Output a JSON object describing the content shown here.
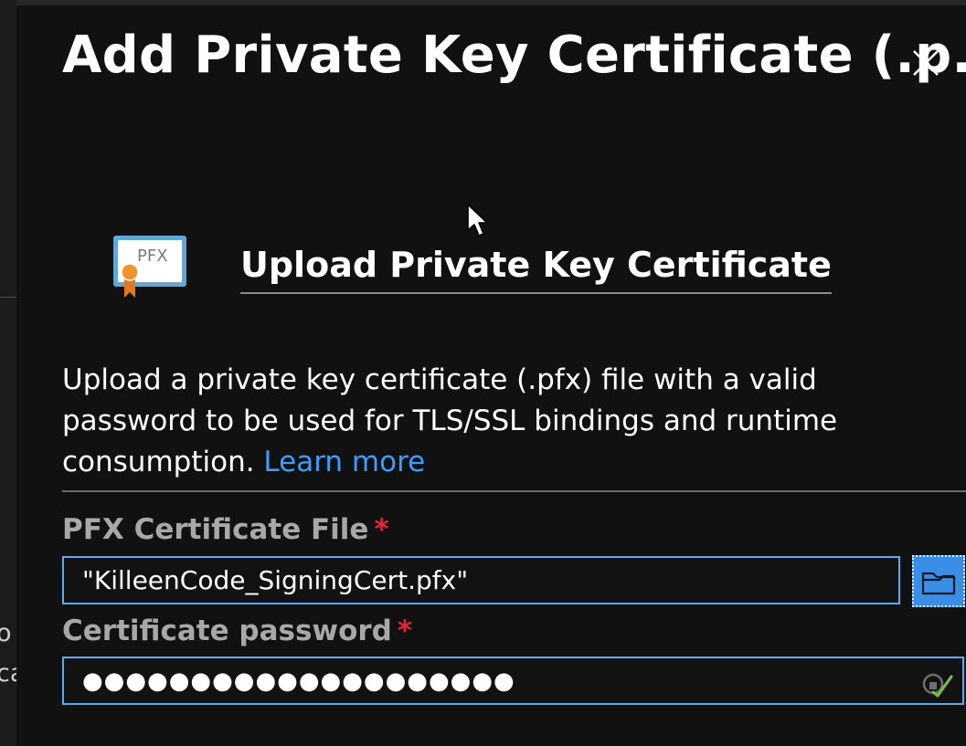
{
  "blade": {
    "title": "Add Private Key Certificate (.p...",
    "close_label": "Close"
  },
  "section": {
    "icon_text": "PFX",
    "title": "Upload Private Key Certificate"
  },
  "description": {
    "text": "Upload a private key certificate (.pfx) file with a valid password to be used for TLS/SSL bindings and runtime consumption.",
    "link_text": "Learn more"
  },
  "fields": {
    "pfx_file": {
      "label": "PFX Certificate File",
      "required_marker": "*",
      "value": "\"KilleenCode_SigningCert.pfx\""
    },
    "password": {
      "label": "Certificate password",
      "required_marker": "*",
      "value": "●●●●●●●●●●●●●●●●●●●●"
    }
  },
  "background": {
    "fragment_1": "o",
    "fragment_2": "ca"
  },
  "colors": {
    "panel_bg": "#111111",
    "accent_blue": "#3b9dff",
    "input_border": "#5aa9f2",
    "required_red": "#e0283a",
    "valid_green": "#7ac143"
  },
  "icons": {
    "close": "close-icon",
    "certificate": "pfx-certificate-icon",
    "browse": "folder-icon",
    "validation": "checkmark-icon"
  }
}
